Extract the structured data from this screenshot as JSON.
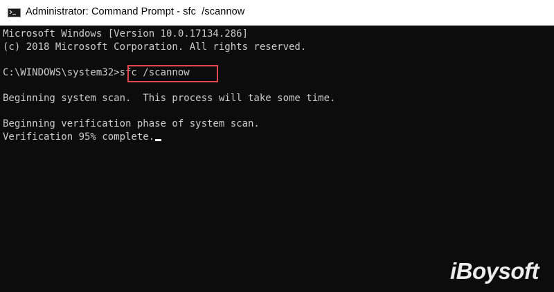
{
  "window": {
    "title": "Administrator: Command Prompt - sfc  /scannow"
  },
  "console": {
    "line1": "Microsoft Windows [Version 10.0.17134.286]",
    "line2": "(c) 2018 Microsoft Corporation. All rights reserved.",
    "prompt": "C:\\WINDOWS\\system32>",
    "command": "sfc /scannow",
    "line4": "Beginning system scan.  This process will take some time.",
    "line5": "Beginning verification phase of system scan.",
    "line6": "Verification 95% complete."
  },
  "watermark": {
    "text": "iBoysoft"
  },
  "colors": {
    "console_bg": "#0c0c0c",
    "console_text": "#cccccc",
    "highlight": "#e5484d",
    "titlebar_bg": "#ffffff"
  },
  "icons": {
    "window_icon": "command-prompt-icon"
  }
}
